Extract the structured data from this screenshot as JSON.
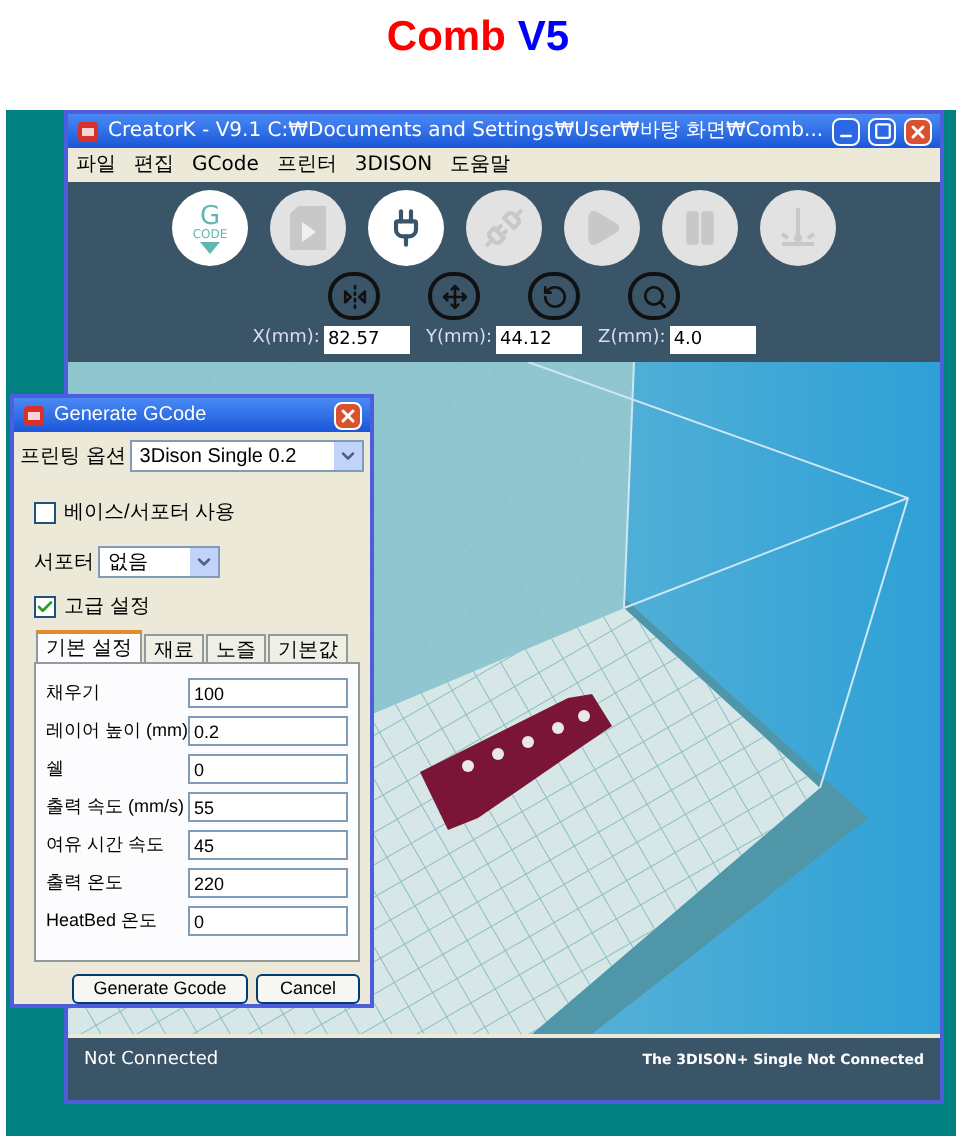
{
  "heading": [
    {
      "text": "Comb",
      "color": "#ff0000"
    },
    {
      "text": "V5",
      "color": "#0000ff"
    }
  ],
  "main_window": {
    "title": "CreatorK - V9.1  C:₩Documents and Settings₩User₩바탕 화면₩Comb...",
    "menu": [
      "파일",
      "편집",
      "GCode",
      "프린터",
      "3DISON",
      "도움말"
    ],
    "toolbar": [
      {
        "kind": "gcode",
        "top": "G",
        "bottom": "CODE",
        "disabled": false
      },
      {
        "kind": "sd-card",
        "disabled": true
      },
      {
        "kind": "connect",
        "disabled": false
      },
      {
        "kind": "disconnect",
        "disabled": true
      },
      {
        "kind": "play",
        "disabled": true
      },
      {
        "kind": "pause",
        "disabled": true
      },
      {
        "kind": "level",
        "disabled": true
      }
    ],
    "view_tools": [
      {
        "kind": "mirror"
      },
      {
        "kind": "move"
      },
      {
        "kind": "rotate"
      },
      {
        "kind": "zoom"
      }
    ],
    "coordinates": [
      {
        "label": "X(mm):",
        "value": "82.57"
      },
      {
        "label": "Y(mm):",
        "value": "44.12"
      },
      {
        "label": "Z(mm):",
        "value": "4.0"
      }
    ],
    "viewport": {
      "kind": "picture"
    },
    "status_bar": {
      "left": "Not Connected",
      "right": "The 3DISON+ Single Not Connected"
    }
  },
  "dialog": {
    "title": "Generate GCode",
    "print_option": {
      "label": "프린팅 옵션",
      "value": "3Dison Single 0.2"
    },
    "support_checkbox": {
      "label": "베이스/서포터 사용",
      "checked": false
    },
    "support_select": {
      "label": "서포터",
      "value": "없음"
    },
    "advanced_checkbox": {
      "label": "고급 설정",
      "checked": true
    },
    "tabs": [
      {
        "label": "기본 설정",
        "selected": true
      },
      {
        "label": "재료",
        "selected": false
      },
      {
        "label": "노즐",
        "selected": false
      },
      {
        "label": "기본값",
        "selected": false
      }
    ],
    "fields": [
      {
        "label": "채우기",
        "value": "100"
      },
      {
        "label": "레이어 높이 (mm)",
        "value": "0.2"
      },
      {
        "label": "쉘",
        "value": "0"
      },
      {
        "label": "출력 속도 (mm/s)",
        "value": "55"
      },
      {
        "label": "여유 시간 속도",
        "value": "45"
      },
      {
        "label": "출력 온도",
        "value": "220"
      },
      {
        "label": "HeatBed 온도",
        "value": "0"
      }
    ],
    "buttons": [
      "Generate Gcode",
      "Cancel"
    ]
  }
}
